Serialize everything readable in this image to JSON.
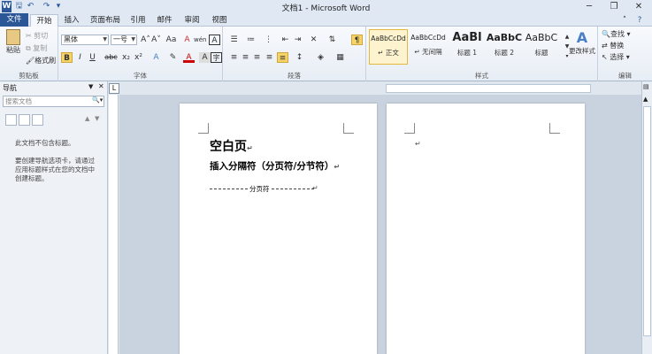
{
  "titlebar": {
    "title": "文档1 - Microsoft Word",
    "app_icon": "W",
    "qat_save_icon": "save-icon",
    "qat_undo_icon": "undo-icon",
    "qat_redo_icon": "redo-icon",
    "minimize": "─",
    "restore": "❐",
    "close": "✕"
  },
  "tabs": [
    "文件",
    "开始",
    "插入",
    "页面布局",
    "引用",
    "邮件",
    "审阅",
    "视图"
  ],
  "ribbon": {
    "clipboard": {
      "label": "剪贴板",
      "paste": "粘贴",
      "cut": "剪切",
      "copy": "复制",
      "format_painter": "格式刷"
    },
    "font": {
      "label": "字体",
      "font_name": "黑体",
      "font_size": "一号",
      "bold": "B",
      "italic": "I",
      "underline": "U",
      "strike": "abc",
      "sub": "x₂",
      "sup": "x²",
      "grow": "A˄",
      "shrink": "A˅",
      "case": "Aa",
      "clear": "A",
      "phonetic": "wén",
      "border": "A"
    },
    "paragraph": {
      "label": "段落"
    },
    "styles": {
      "label": "样式",
      "items": [
        {
          "sample": "AaBbCcDd",
          "name": "↵ 正文"
        },
        {
          "sample": "AaBbCcDd",
          "name": "↵ 无间隔"
        },
        {
          "sample": "AaBl",
          "name": "标题 1"
        },
        {
          "sample": "AaBbC",
          "name": "标题 2"
        },
        {
          "sample": "AaBbC",
          "name": "标题"
        }
      ],
      "change_styles": "更改样式"
    },
    "editing": {
      "label": "编辑",
      "find": "查找",
      "replace": "替换",
      "select": "选择"
    }
  },
  "navpane": {
    "title": "导航",
    "search_placeholder": "搜索文档",
    "msg1": "此文档不包含标题。",
    "msg2": "要创建导航选项卡，请通过应用标题样式在您的文档中创建标题。"
  },
  "document": {
    "page1_heading": "空白页",
    "page1_subheading": "插入分隔符（分页符/分节符）",
    "break_label": "分页符",
    "para_mark": "↵"
  }
}
